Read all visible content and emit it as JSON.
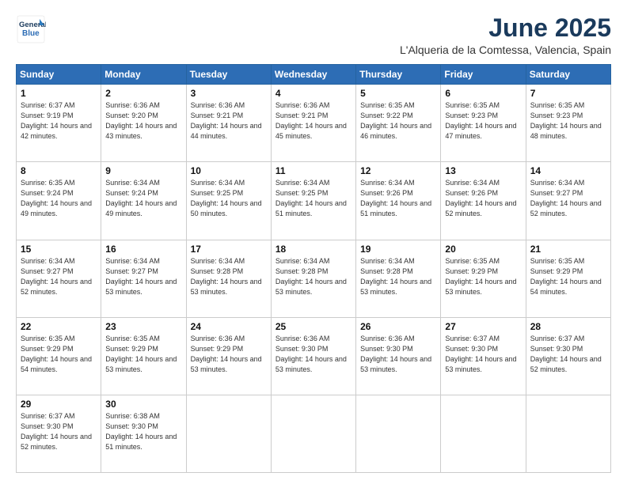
{
  "logo": {
    "line1": "General",
    "line2": "Blue"
  },
  "title": "June 2025",
  "subtitle": "L'Alqueria de la Comtessa, Valencia, Spain",
  "days_header": [
    "Sunday",
    "Monday",
    "Tuesday",
    "Wednesday",
    "Thursday",
    "Friday",
    "Saturday"
  ],
  "weeks": [
    [
      {
        "num": "1",
        "sunrise": "6:37 AM",
        "sunset": "9:19 PM",
        "daylight": "14 hours and 42 minutes."
      },
      {
        "num": "2",
        "sunrise": "6:36 AM",
        "sunset": "9:20 PM",
        "daylight": "14 hours and 43 minutes."
      },
      {
        "num": "3",
        "sunrise": "6:36 AM",
        "sunset": "9:21 PM",
        "daylight": "14 hours and 44 minutes."
      },
      {
        "num": "4",
        "sunrise": "6:36 AM",
        "sunset": "9:21 PM",
        "daylight": "14 hours and 45 minutes."
      },
      {
        "num": "5",
        "sunrise": "6:35 AM",
        "sunset": "9:22 PM",
        "daylight": "14 hours and 46 minutes."
      },
      {
        "num": "6",
        "sunrise": "6:35 AM",
        "sunset": "9:23 PM",
        "daylight": "14 hours and 47 minutes."
      },
      {
        "num": "7",
        "sunrise": "6:35 AM",
        "sunset": "9:23 PM",
        "daylight": "14 hours and 48 minutes."
      }
    ],
    [
      {
        "num": "8",
        "sunrise": "6:35 AM",
        "sunset": "9:24 PM",
        "daylight": "14 hours and 49 minutes."
      },
      {
        "num": "9",
        "sunrise": "6:34 AM",
        "sunset": "9:24 PM",
        "daylight": "14 hours and 49 minutes."
      },
      {
        "num": "10",
        "sunrise": "6:34 AM",
        "sunset": "9:25 PM",
        "daylight": "14 hours and 50 minutes."
      },
      {
        "num": "11",
        "sunrise": "6:34 AM",
        "sunset": "9:25 PM",
        "daylight": "14 hours and 51 minutes."
      },
      {
        "num": "12",
        "sunrise": "6:34 AM",
        "sunset": "9:26 PM",
        "daylight": "14 hours and 51 minutes."
      },
      {
        "num": "13",
        "sunrise": "6:34 AM",
        "sunset": "9:26 PM",
        "daylight": "14 hours and 52 minutes."
      },
      {
        "num": "14",
        "sunrise": "6:34 AM",
        "sunset": "9:27 PM",
        "daylight": "14 hours and 52 minutes."
      }
    ],
    [
      {
        "num": "15",
        "sunrise": "6:34 AM",
        "sunset": "9:27 PM",
        "daylight": "14 hours and 52 minutes."
      },
      {
        "num": "16",
        "sunrise": "6:34 AM",
        "sunset": "9:27 PM",
        "daylight": "14 hours and 53 minutes."
      },
      {
        "num": "17",
        "sunrise": "6:34 AM",
        "sunset": "9:28 PM",
        "daylight": "14 hours and 53 minutes."
      },
      {
        "num": "18",
        "sunrise": "6:34 AM",
        "sunset": "9:28 PM",
        "daylight": "14 hours and 53 minutes."
      },
      {
        "num": "19",
        "sunrise": "6:34 AM",
        "sunset": "9:28 PM",
        "daylight": "14 hours and 53 minutes."
      },
      {
        "num": "20",
        "sunrise": "6:35 AM",
        "sunset": "9:29 PM",
        "daylight": "14 hours and 53 minutes."
      },
      {
        "num": "21",
        "sunrise": "6:35 AM",
        "sunset": "9:29 PM",
        "daylight": "14 hours and 54 minutes."
      }
    ],
    [
      {
        "num": "22",
        "sunrise": "6:35 AM",
        "sunset": "9:29 PM",
        "daylight": "14 hours and 54 minutes."
      },
      {
        "num": "23",
        "sunrise": "6:35 AM",
        "sunset": "9:29 PM",
        "daylight": "14 hours and 53 minutes."
      },
      {
        "num": "24",
        "sunrise": "6:36 AM",
        "sunset": "9:29 PM",
        "daylight": "14 hours and 53 minutes."
      },
      {
        "num": "25",
        "sunrise": "6:36 AM",
        "sunset": "9:30 PM",
        "daylight": "14 hours and 53 minutes."
      },
      {
        "num": "26",
        "sunrise": "6:36 AM",
        "sunset": "9:30 PM",
        "daylight": "14 hours and 53 minutes."
      },
      {
        "num": "27",
        "sunrise": "6:37 AM",
        "sunset": "9:30 PM",
        "daylight": "14 hours and 53 minutes."
      },
      {
        "num": "28",
        "sunrise": "6:37 AM",
        "sunset": "9:30 PM",
        "daylight": "14 hours and 52 minutes."
      }
    ],
    [
      {
        "num": "29",
        "sunrise": "6:37 AM",
        "sunset": "9:30 PM",
        "daylight": "14 hours and 52 minutes."
      },
      {
        "num": "30",
        "sunrise": "6:38 AM",
        "sunset": "9:30 PM",
        "daylight": "14 hours and 51 minutes."
      },
      null,
      null,
      null,
      null,
      null
    ]
  ]
}
